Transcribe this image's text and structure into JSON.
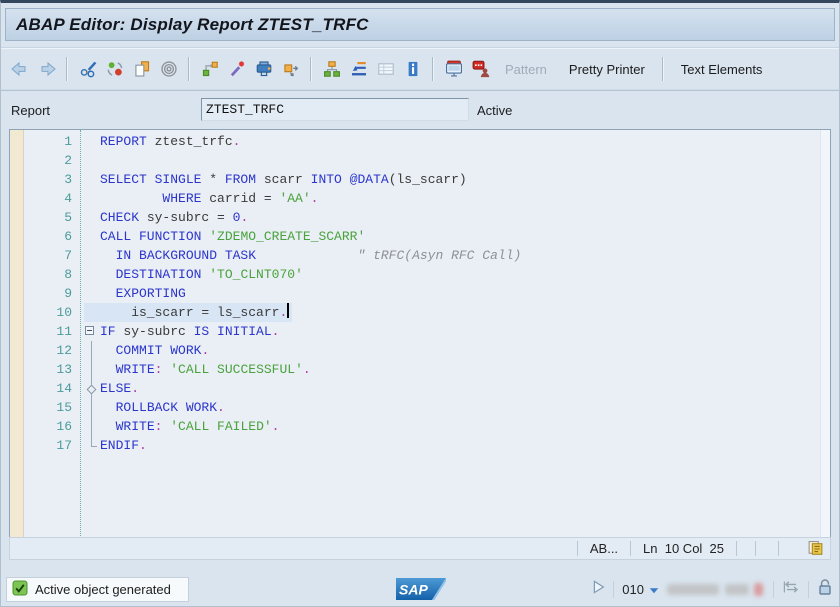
{
  "window": {
    "title": "ABAP Editor: Display Report ZTEST_TRFC"
  },
  "toolbar": {
    "icons": [
      "back",
      "forward",
      "display-change",
      "refresh",
      "copy",
      "spiral",
      "where-used",
      "pattern-wand",
      "syntax-check",
      "copy-arrows",
      "object-hierarchy",
      "sort",
      "table-view",
      "info",
      "display-views",
      "stop-transaction"
    ],
    "pattern_label": "Pattern",
    "pretty_printer_label": "Pretty Printer",
    "text_elements_label": "Text Elements"
  },
  "form": {
    "report_label": "Report",
    "report_value": "ZTEST_TRFC",
    "status_label": "Active"
  },
  "editor": {
    "lines": [
      {
        "n": 1,
        "fold": "none",
        "current": false,
        "tokens": [
          [
            "k",
            "REPORT"
          ],
          [
            "d",
            " ztest_trfc"
          ],
          [
            "p",
            "."
          ]
        ]
      },
      {
        "n": 2,
        "fold": "none",
        "current": false,
        "tokens": []
      },
      {
        "n": 3,
        "fold": "none",
        "current": false,
        "tokens": [
          [
            "k",
            "SELECT SINGLE"
          ],
          [
            "d",
            " * "
          ],
          [
            "k",
            "FROM"
          ],
          [
            "d",
            " scarr "
          ],
          [
            "k",
            "INTO"
          ],
          [
            "d",
            " "
          ],
          [
            "k",
            "@DATA"
          ],
          [
            "d",
            "(ls_scarr)"
          ]
        ]
      },
      {
        "n": 4,
        "fold": "none",
        "current": false,
        "tokens": [
          [
            "d",
            "        "
          ],
          [
            "k",
            "WHERE"
          ],
          [
            "d",
            " carrid = "
          ],
          [
            "s",
            "'AA'"
          ],
          [
            "p",
            "."
          ]
        ]
      },
      {
        "n": 5,
        "fold": "none",
        "current": false,
        "tokens": [
          [
            "k",
            "CHECK"
          ],
          [
            "d",
            " sy-subrc = "
          ],
          [
            "n",
            "0"
          ],
          [
            "p",
            "."
          ]
        ]
      },
      {
        "n": 6,
        "fold": "none",
        "current": false,
        "tokens": [
          [
            "k",
            "CALL FUNCTION"
          ],
          [
            "d",
            " "
          ],
          [
            "s",
            "'ZDEMO_CREATE_SCARR'"
          ]
        ]
      },
      {
        "n": 7,
        "fold": "none",
        "current": false,
        "tokens": [
          [
            "d",
            "  "
          ],
          [
            "k",
            "IN BACKGROUND TASK"
          ],
          [
            "d",
            "             "
          ],
          [
            "c",
            "\" tRFC(Asyn RFC Call)"
          ]
        ]
      },
      {
        "n": 8,
        "fold": "none",
        "current": false,
        "tokens": [
          [
            "d",
            "  "
          ],
          [
            "k",
            "DESTINATION"
          ],
          [
            "d",
            " "
          ],
          [
            "s",
            "'TO_CLNT070'"
          ]
        ]
      },
      {
        "n": 9,
        "fold": "none",
        "current": false,
        "tokens": [
          [
            "d",
            "  "
          ],
          [
            "k",
            "EXPORTING"
          ]
        ]
      },
      {
        "n": 10,
        "fold": "none",
        "current": true,
        "tokens": [
          [
            "d",
            "    is_scarr = ls_scarr"
          ],
          [
            "p",
            "."
          ]
        ]
      },
      {
        "n": 11,
        "fold": "start",
        "current": false,
        "tokens": [
          [
            "k",
            "IF"
          ],
          [
            "d",
            " sy-subrc "
          ],
          [
            "k",
            "IS INITIAL"
          ],
          [
            "p",
            "."
          ]
        ]
      },
      {
        "n": 12,
        "fold": "mid",
        "current": false,
        "tokens": [
          [
            "d",
            "  "
          ],
          [
            "k",
            "COMMIT WORK"
          ],
          [
            "p",
            "."
          ]
        ]
      },
      {
        "n": 13,
        "fold": "mid",
        "current": false,
        "tokens": [
          [
            "d",
            "  "
          ],
          [
            "k",
            "WRITE"
          ],
          [
            "p",
            ":"
          ],
          [
            "d",
            " "
          ],
          [
            "s",
            "'CALL SUCCESSFUL'"
          ],
          [
            "p",
            "."
          ]
        ]
      },
      {
        "n": 14,
        "fold": "else",
        "current": false,
        "tokens": [
          [
            "k",
            "ELSE"
          ],
          [
            "p",
            "."
          ]
        ]
      },
      {
        "n": 15,
        "fold": "mid",
        "current": false,
        "tokens": [
          [
            "d",
            "  "
          ],
          [
            "k",
            "ROLLBACK WORK"
          ],
          [
            "p",
            "."
          ]
        ]
      },
      {
        "n": 16,
        "fold": "mid",
        "current": false,
        "tokens": [
          [
            "d",
            "  "
          ],
          [
            "k",
            "WRITE"
          ],
          [
            "p",
            ":"
          ],
          [
            "d",
            " "
          ],
          [
            "s",
            "'CALL FAILED'"
          ],
          [
            "p",
            "."
          ]
        ]
      },
      {
        "n": 17,
        "fold": "end",
        "current": false,
        "tokens": [
          [
            "k",
            "ENDIF"
          ],
          [
            "p",
            "."
          ]
        ]
      }
    ]
  },
  "editor_status": {
    "perspective": "AB...",
    "position": "Ln  10 Col  25"
  },
  "statusbar": {
    "message": "Active object generated",
    "sap_logo_text": "SAP",
    "client": "010"
  },
  "colors": {
    "keyword": "#2c35cc",
    "string": "#4aa23c",
    "comment": "#8d9094",
    "punctuation": "#b03aa0",
    "line_number": "#4d9b9b",
    "current_line_highlight": "#d8e5f4",
    "title_bar": "#c6d8e8",
    "editor_background": "#e9eff5"
  }
}
